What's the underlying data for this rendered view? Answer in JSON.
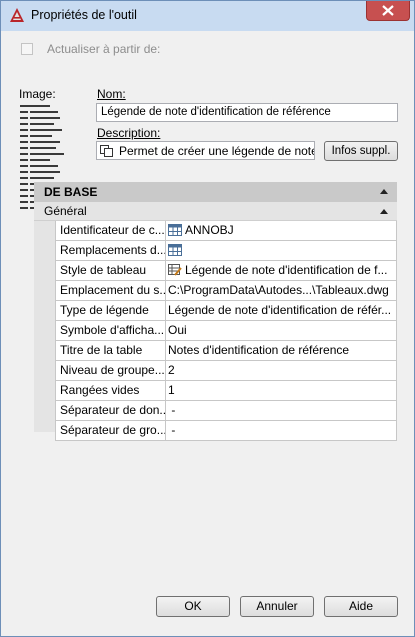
{
  "window": {
    "title": "Propriétés de l'outil"
  },
  "update": {
    "label": "Actualiser à partir de:",
    "checked": false
  },
  "image": {
    "label": "Image:"
  },
  "name": {
    "label": "Nom:",
    "value": "Légende de note d'identification de référence"
  },
  "description": {
    "label": "Description:",
    "value": "Permet de créer une légende de note"
  },
  "info_button": {
    "label": "Infos suppl."
  },
  "grid": {
    "section": "DE BASE",
    "subsection": "Général",
    "rows": [
      {
        "name": "Identificateur de c...",
        "value": "ANNOBJ",
        "icon": "table-icon"
      },
      {
        "name": "Remplacements d...",
        "value": "",
        "icon": "table-icon"
      },
      {
        "name": "Style de tableau",
        "value": "Légende de note d'identification de f...",
        "icon": "table-style-icon"
      },
      {
        "name": "Emplacement du s...",
        "value": "C:\\ProgramData\\Autodes...\\Tableaux.dwg"
      },
      {
        "name": "Type de légende",
        "value": "Légende de note d'identification de référ..."
      },
      {
        "name": "Symbole d'afficha...",
        "value": "Oui"
      },
      {
        "name": "Titre de la table",
        "value": "Notes d'identification de référence"
      },
      {
        "name": "Niveau de groupe...",
        "value": "2"
      },
      {
        "name": "Rangées vides",
        "value": "1"
      },
      {
        "name": "Séparateur de don...",
        "value": "-"
      },
      {
        "name": "Séparateur de gro...",
        "value": "-"
      }
    ]
  },
  "buttons": {
    "ok": "OK",
    "cancel": "Annuler",
    "help": "Aide"
  },
  "colors": {
    "titlebar": "#c8dbf1",
    "close": "#c75050",
    "section": "#c9c9c9",
    "subsection": "#e4e4e4"
  }
}
